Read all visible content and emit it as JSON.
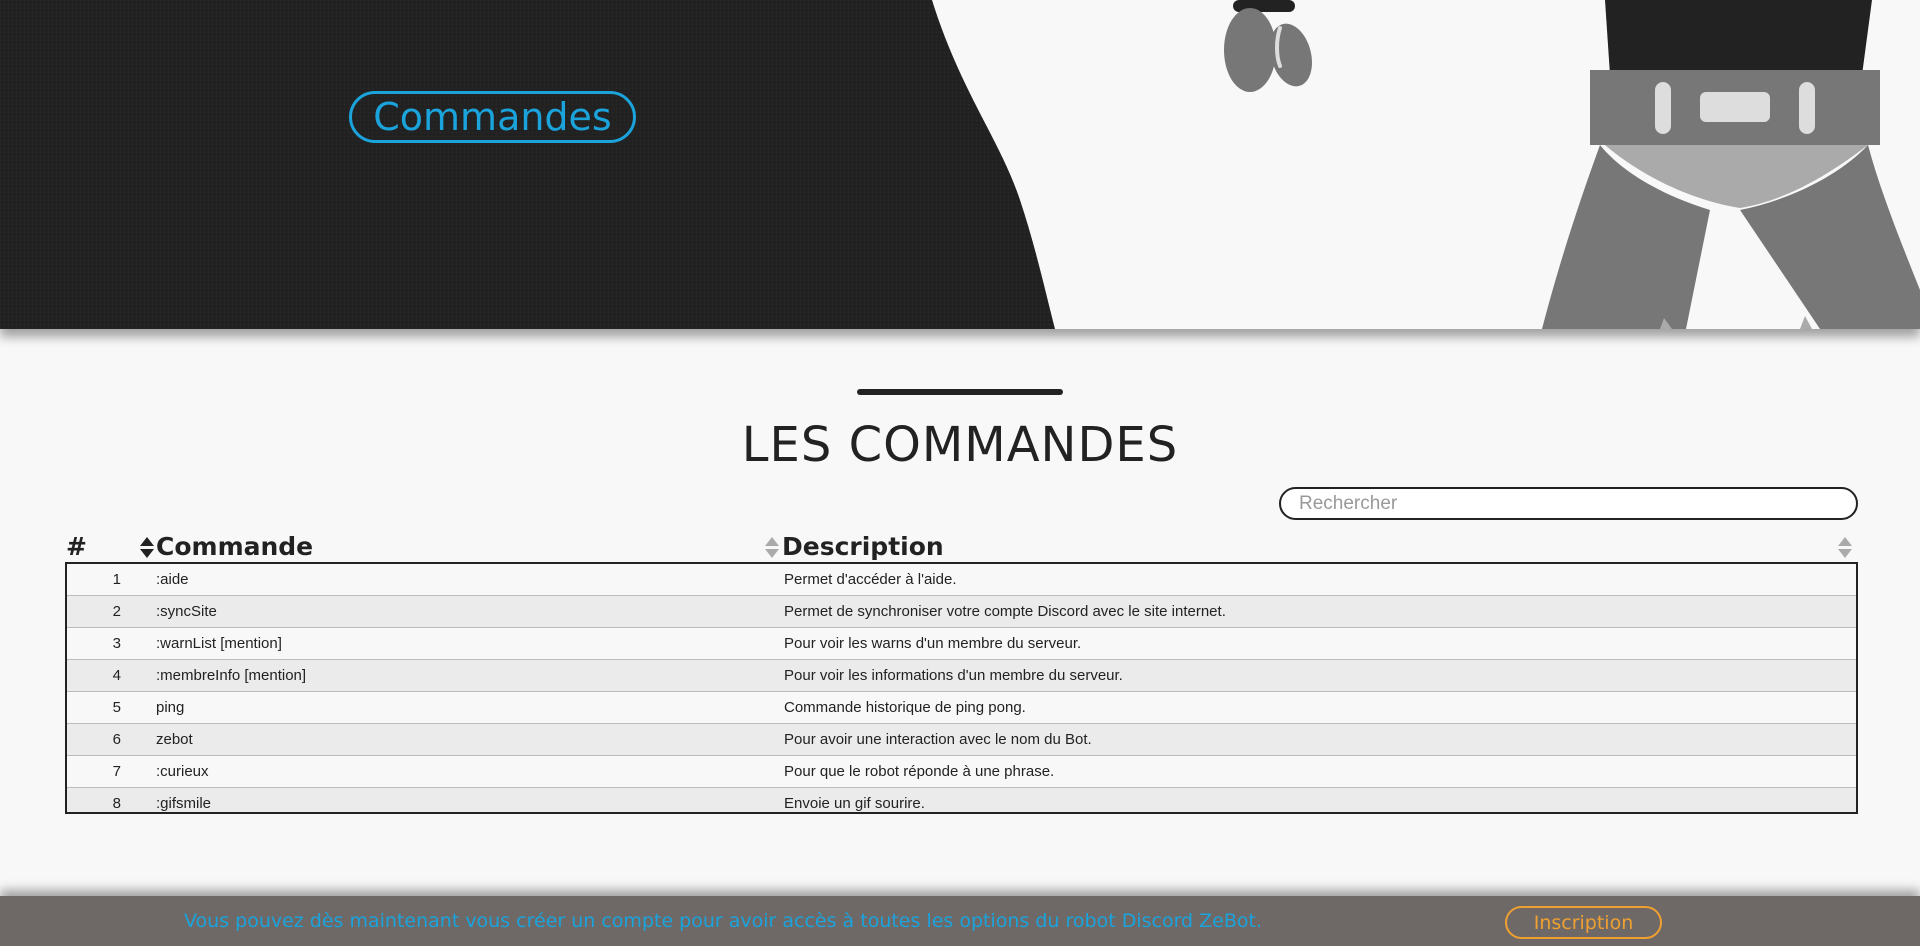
{
  "hero": {
    "button_label": "Commandes"
  },
  "section": {
    "title": "LES COMMANDES"
  },
  "search": {
    "placeholder": "Rechercher",
    "value": ""
  },
  "table": {
    "headers": {
      "num": "#",
      "command": "Commande",
      "description": "Description"
    },
    "rows": [
      {
        "num": "1",
        "command": ":aide",
        "description": "Permet d'accéder à l'aide."
      },
      {
        "num": "2",
        "command": ":syncSite",
        "description": "Permet de synchroniser votre compte Discord avec le site internet."
      },
      {
        "num": "3",
        "command": ":warnList [mention]",
        "description": "Pour voir les warns d'un membre du serveur."
      },
      {
        "num": "4",
        "command": ":membreInfo [mention]",
        "description": "Pour voir les informations d'un membre du serveur."
      },
      {
        "num": "5",
        "command": "ping",
        "description": "Commande historique de ping pong."
      },
      {
        "num": "6",
        "command": "zebot",
        "description": "Pour avoir une interaction avec le nom du Bot."
      },
      {
        "num": "7",
        "command": ":curieux",
        "description": "Pour que le robot réponde à une phrase."
      },
      {
        "num": "8",
        "command": ":gifsmile",
        "description": "Envoie un gif sourire."
      }
    ]
  },
  "footer": {
    "message": "Vous pouvez dès maintenant vous créer un compte pour avoir accès à toutes les options du robot Discord ZeBot.",
    "button_label": "Inscription"
  },
  "colors": {
    "accent": "#1ba3dc",
    "footer_button": "#f0a030",
    "hero_dark": "#222222",
    "footer_bg": "#6e6967"
  },
  "icons": [
    "sort-icon",
    "robot-illustration"
  ]
}
